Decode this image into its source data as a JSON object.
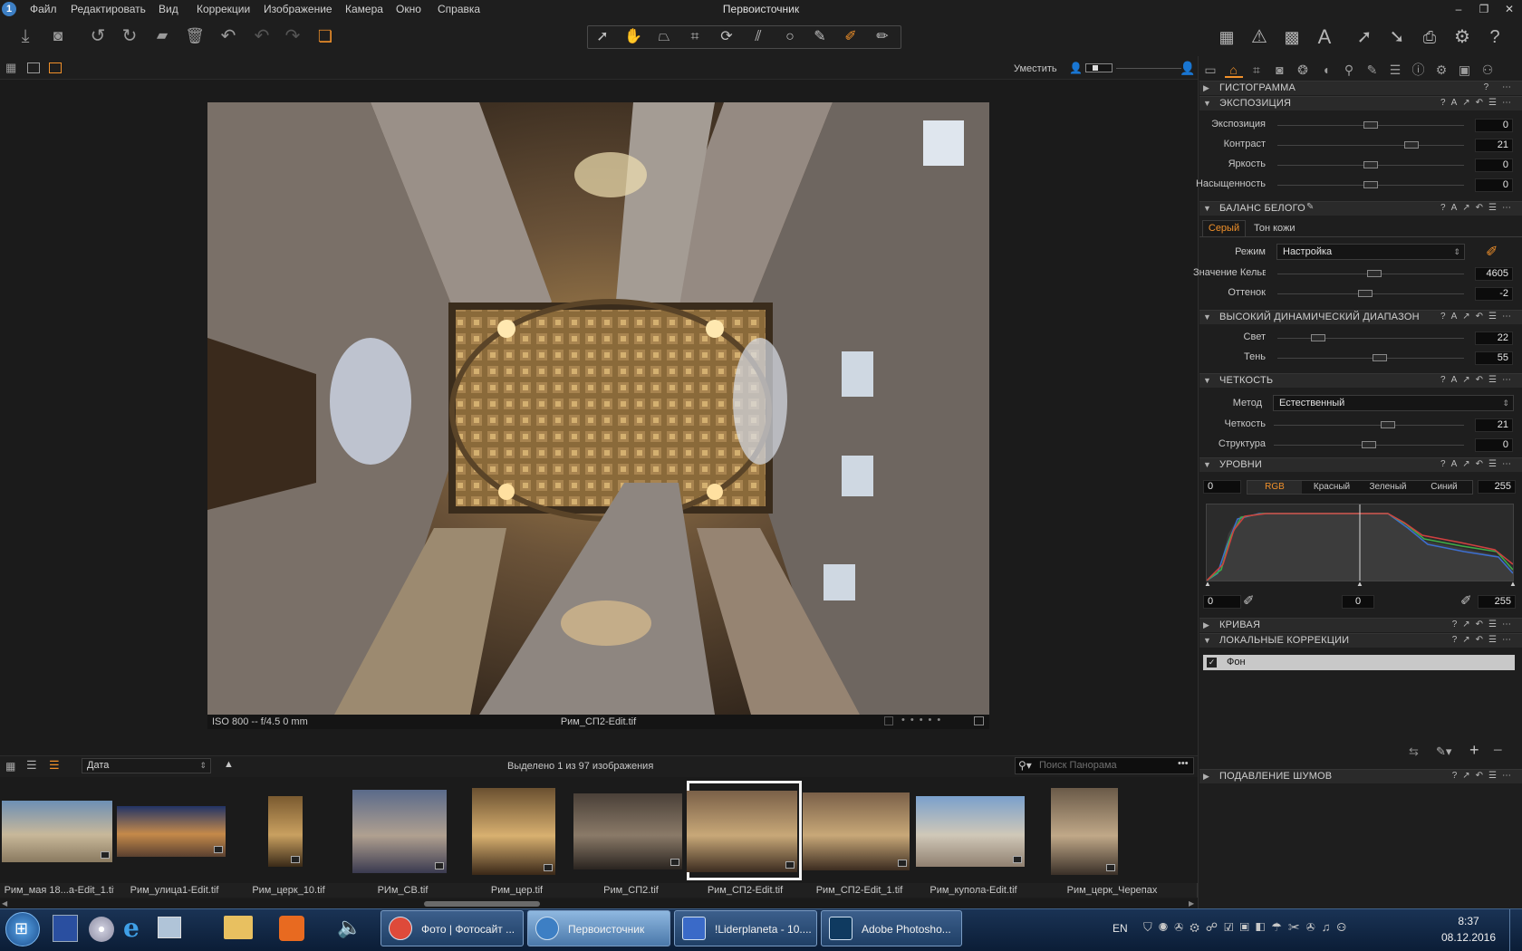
{
  "app": {
    "title": "Первоисточник",
    "icon_glyph": "1",
    "menu": [
      "Файл",
      "Редактировать",
      "Вид",
      "Коррекции",
      "Изображение",
      "Камера",
      "Окно",
      "Справка"
    ],
    "window_controls": [
      "–",
      "❐",
      "✕"
    ]
  },
  "toolbar": {
    "left_icons": [
      "import-icon",
      "camera-icon",
      "rotate-left-icon",
      "rotate-right-icon",
      "export-folder-icon",
      "trash-icon",
      "reset-icon",
      "undo-icon",
      "redo-icon",
      "copy-stack-icon"
    ],
    "tool_icons": [
      "pointer-tool-icon",
      "hand-tool-icon",
      "crop-keystone-icon",
      "crop-icon",
      "rotate-tool-icon",
      "straighten-icon",
      "circle-mask-icon",
      "brush-icon",
      "picker-icon",
      "eraser-icon"
    ],
    "right_icons": [
      "grid-view-icon",
      "warning-icon",
      "grid-overlay-icon",
      "text-icon",
      "arrow-up-icon",
      "arrow-down-icon",
      "print-icon",
      "gear-icon",
      "help-icon"
    ]
  },
  "viewbar": {
    "fit_label": "Уместить"
  },
  "viewer": {
    "caption_left": "ISO 800 -- f/4.5 0 mm",
    "caption_center": "Рим_СП2-Edit.tif"
  },
  "browser": {
    "sort_value": "Дата",
    "selected_text": "Выделено 1 из 97 изображения",
    "search_placeholder": "Поиск Панорама",
    "thumbnails": [
      {
        "label": "Рим_мая 18...а-Edit_1.tif",
        "colors": [
          "#6d8fb5",
          "#c8b89a",
          "#8a7a60"
        ]
      },
      {
        "label": "Рим_улица1-Edit.tif",
        "colors": [
          "#223466",
          "#c58a4a",
          "#5a4030"
        ]
      },
      {
        "label": "Рим_церк_10.tif",
        "colors": [
          "#7a5a30",
          "#c9a060",
          "#3a2a18"
        ]
      },
      {
        "label": "РИм_СВ.tif",
        "colors": [
          "#5a6a8a",
          "#b0a090",
          "#3a3a50"
        ]
      },
      {
        "label": "Рим_цер.tif",
        "colors": [
          "#6a5030",
          "#d8b070",
          "#3a2818"
        ]
      },
      {
        "label": "Рим_СП2.tif",
        "colors": [
          "#4a4038",
          "#8a7a68",
          "#2a2420"
        ]
      },
      {
        "label": "Рим_СП2-Edit.tif",
        "colors": [
          "#7a6048",
          "#c8a878",
          "#3c2c20"
        ]
      },
      {
        "label": "Рим_СП2-Edit_1.tif",
        "colors": [
          "#7a6048",
          "#c8a878",
          "#3c2c20"
        ]
      },
      {
        "label": "Рим_купола-Edit.tif",
        "colors": [
          "#7aa0cc",
          "#d0c8b8",
          "#908070"
        ]
      },
      {
        "label": "Рим_церк_Черепах",
        "colors": [
          "#6a5a48",
          "#c0a888",
          "#3a3028"
        ]
      }
    ]
  },
  "panel": {
    "tab_icons": [
      "folder-tab-icon",
      "capture-tab-icon",
      "crop-tab-icon",
      "camera-tab-icon",
      "color-tab-icon",
      "lens-tab-icon",
      "search-tab-icon",
      "brush-tab-icon",
      "details-tab-icon",
      "info-tab-icon",
      "settings-tab-icon",
      "batch-tab-icon",
      "more-tab-icon"
    ],
    "histogram_title": "ГИСТОГРАММА",
    "exposure": {
      "title": "ЭКСПОЗИЦИЯ",
      "rows": [
        {
          "label": "Экспозиция",
          "value": "0",
          "pos": 0.5
        },
        {
          "label": "Контраст",
          "value": "21",
          "pos": 0.72
        },
        {
          "label": "Яркость",
          "value": "0",
          "pos": 0.5
        },
        {
          "label": "Насыщенность",
          "value": "0",
          "pos": 0.5
        }
      ]
    },
    "white_balance": {
      "title": "БАЛАНС БЕЛОГО",
      "tabs": [
        "Серый",
        "Тон кожи"
      ],
      "mode_label": "Режим",
      "mode_value": "Настройка",
      "rows": [
        {
          "label": "Значение Кельвина",
          "value": "4605",
          "pos": 0.52
        },
        {
          "label": "Оттенок",
          "value": "-2",
          "pos": 0.47
        }
      ]
    },
    "hdr": {
      "title": "ВЫСОКИЙ ДИНАМИЧЕСКИЙ ДИАПАЗОН",
      "rows": [
        {
          "label": "Свет",
          "value": "22",
          "pos": 0.22
        },
        {
          "label": "Тень",
          "value": "55",
          "pos": 0.55
        }
      ]
    },
    "clarity": {
      "title": "ЧЕТКОСТЬ",
      "method_label": "Метод",
      "method_value": "Естественный",
      "rows": [
        {
          "label": "Четкость",
          "value": "21",
          "pos": 0.6
        },
        {
          "label": "Структура",
          "value": "0",
          "pos": 0.5
        }
      ]
    },
    "levels": {
      "title": "УРОВНИ",
      "input_low": "0",
      "input_high": "255",
      "channels": [
        "RGB",
        "Красный",
        "Зеленый",
        "Синий"
      ],
      "output_low": "0",
      "midpoint": "0",
      "output_high": "255"
    },
    "curve_title": "КРИВАЯ",
    "local": {
      "title": "ЛОКАЛЬНЫЕ КОРРЕКЦИИ",
      "layer": "Фон"
    },
    "noise_title": "ПОДАВЛЕНИЕ ШУМОВ"
  },
  "taskbar": {
    "buttons": [
      {
        "label": "Фото | Фотосайт ...",
        "icon": "chrome-icon"
      },
      {
        "label": "Первоисточник",
        "icon": "capture-one-icon"
      },
      {
        "label": "!Liderplaneta - 10....",
        "icon": "word-icon"
      },
      {
        "label": "Adobe Photosho...",
        "icon": "photoshop-icon"
      }
    ],
    "lang": "EN",
    "time": "8:37",
    "date": "08.12.2016"
  },
  "colors": {
    "accent": "#f0902a",
    "panel_bg": "#1e1e1e",
    "section_bg": "#2a2a2a"
  }
}
